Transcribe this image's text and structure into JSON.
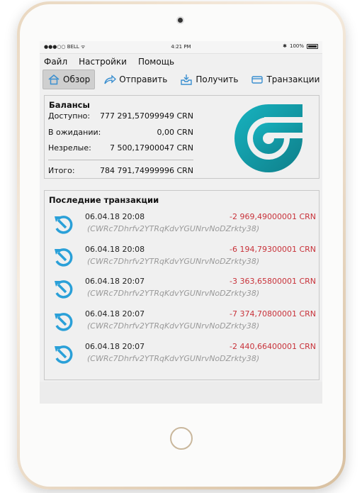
{
  "status": {
    "carrier": "BELL",
    "time": "4:21 PM",
    "battery": "100%"
  },
  "menu": [
    "Файл",
    "Настройки",
    "Помощь"
  ],
  "toolbar": {
    "overview": "Обзор",
    "send": "Отправить",
    "receive": "Получить",
    "transactions": "Транзакции"
  },
  "balances": {
    "title": "Балансы",
    "available_label": "Доступно:",
    "available_value": "777 291,57099949 CRN",
    "pending_label": "В ожидании:",
    "pending_value": "0,00 CRN",
    "immature_label": "Незрелые:",
    "immature_value": "7 500,17900047 CRN",
    "total_label": "Итого:",
    "total_value": "784 791,74999996 CRN"
  },
  "recent": {
    "title": "Последние транзакции",
    "items": [
      {
        "date": "06.04.18 20:08",
        "address": "(CWRc7Dhrfv2YTRqKdvYGUNrvNoDZrkty38)",
        "amount": "-2 969,49000001 CRN"
      },
      {
        "date": "06.04.18 20:08",
        "address": "(CWRc7Dhrfv2YTRqKdvYGUNrvNoDZrkty38)",
        "amount": "-6 194,79300001 CRN"
      },
      {
        "date": "06.04.18 20:07",
        "address": "(CWRc7Dhrfv2YTRqKdvYGUNrvNoDZrkty38)",
        "amount": "-3 363,65800001 CRN"
      },
      {
        "date": "06.04.18 20:07",
        "address": "(CWRc7Dhrfv2YTRqKdvYGUNrvNoDZrkty38)",
        "amount": "-7 374,70800001 CRN"
      },
      {
        "date": "06.04.18 20:07",
        "address": "(CWRc7Dhrfv2YTRqKdvYGUNrvNoDZrkty38)",
        "amount": "-2 440,66400001 CRN"
      }
    ]
  },
  "colors": {
    "negative": "#c8323a",
    "accent": "#2aa0d8",
    "logo": "#149aa6"
  }
}
